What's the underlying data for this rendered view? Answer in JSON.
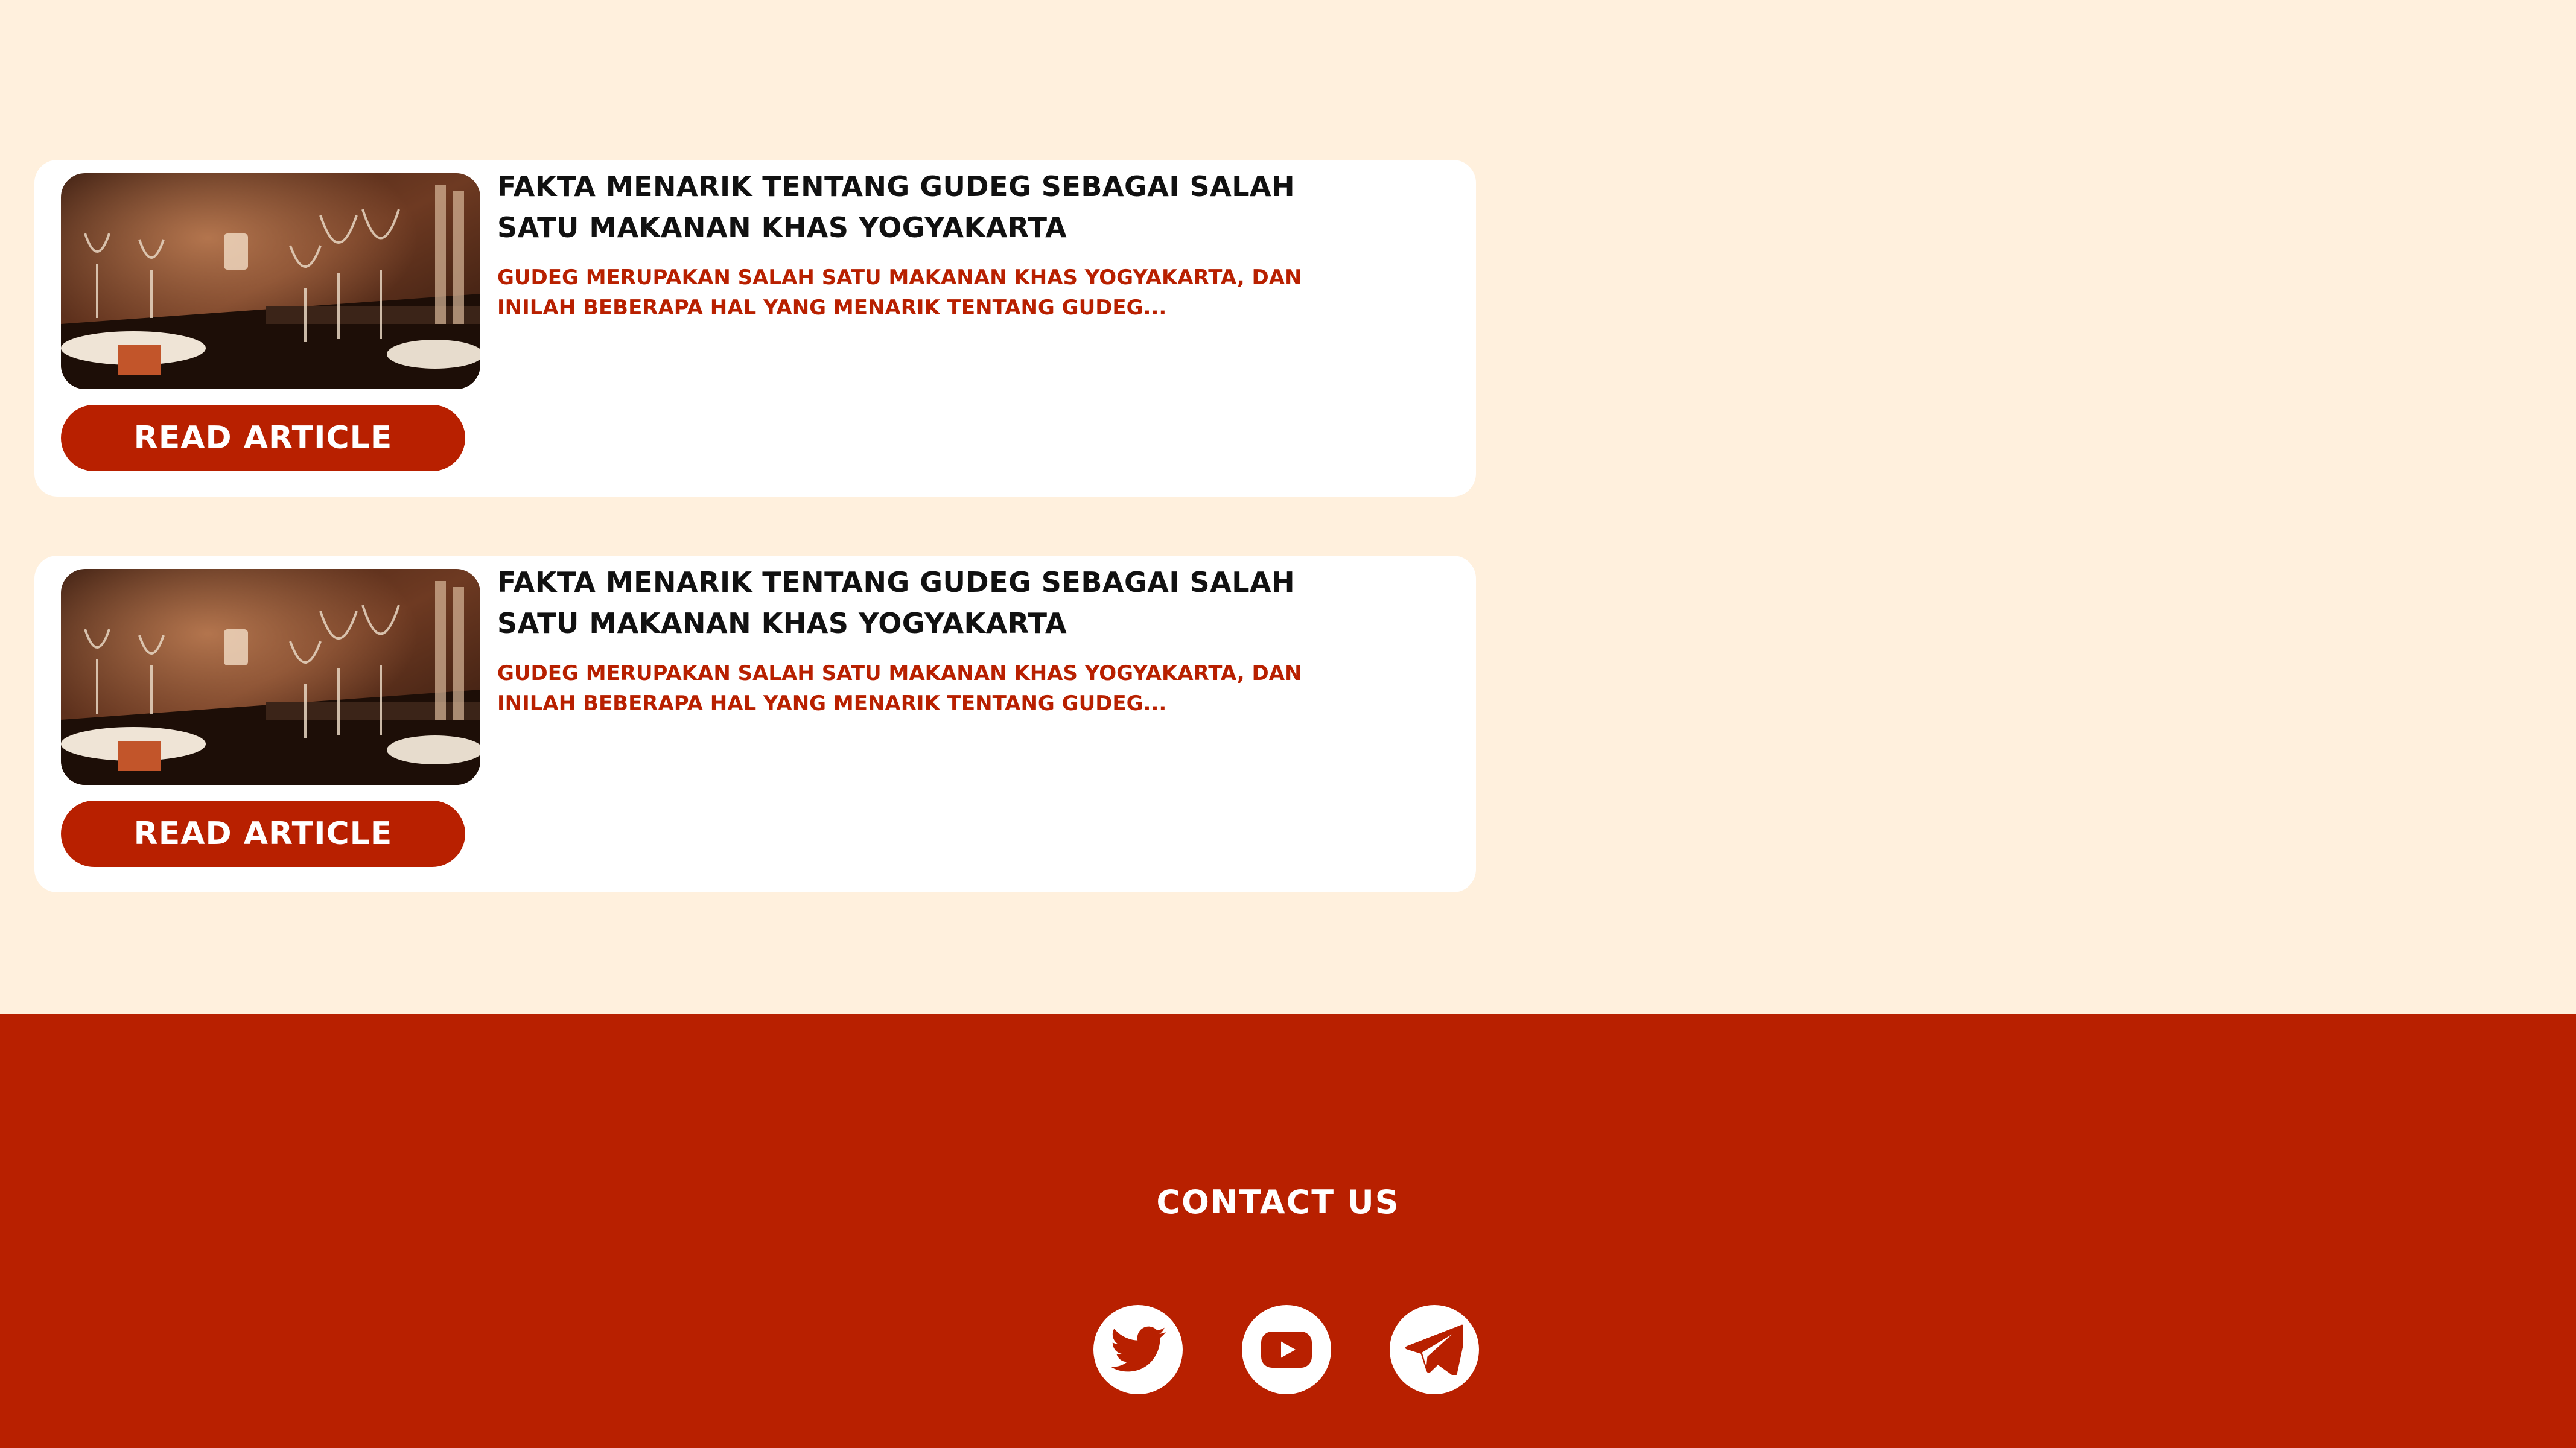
{
  "articles": [
    {
      "title": "Fakta Menarik Tentang Gudeg Sebagai Salah Satu Makanan Khas Yogyakarta",
      "excerpt": "Gudeg merupakan salah satu makanan khas Yogyakarta, dan inilah beberapa hal yang menarik tentang gudeg...",
      "button_label": "Read Article",
      "image_icon": "restaurant-table-photo"
    },
    {
      "title": "Fakta Menarik Tentang Gudeg Sebagai Salah Satu Makanan Khas Yogyakarta",
      "excerpt": "Gudeg merupakan salah satu makanan khas Yogyakarta, dan inilah beberapa hal yang menarik tentang gudeg...",
      "button_label": "Read Article",
      "image_icon": "restaurant-table-photo"
    }
  ],
  "footer": {
    "contact_title": "Contact Us",
    "social": [
      {
        "name": "twitter",
        "icon": "twitter-icon"
      },
      {
        "name": "youtube",
        "icon": "youtube-icon"
      },
      {
        "name": "telegram",
        "icon": "telegram-icon"
      }
    ]
  },
  "colors": {
    "page_background": "#fff0dd",
    "card_background": "#ffffff",
    "accent": "#b82000",
    "title_text": "#111111",
    "footer_text": "#ffffff"
  }
}
